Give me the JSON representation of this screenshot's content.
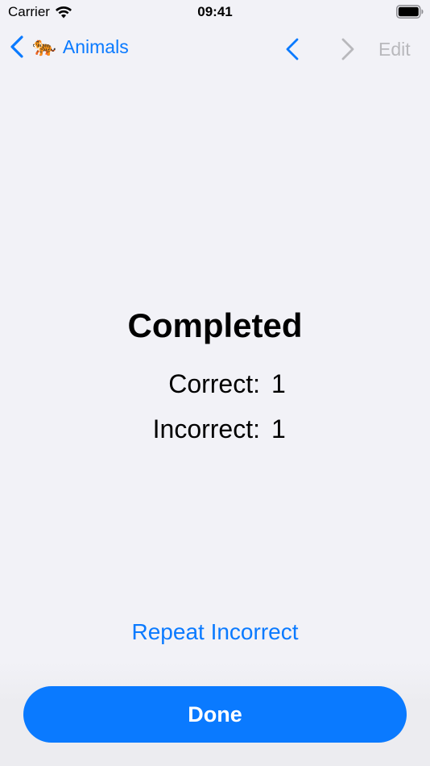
{
  "status_bar": {
    "carrier": "Carrier",
    "time": "09:41"
  },
  "nav": {
    "back_emoji": "🐅",
    "back_label": "Animals",
    "edit_label": "Edit",
    "accent_color": "#0a7aff",
    "disabled_color": "#b8b8bc"
  },
  "result": {
    "title": "Completed",
    "correct_label": "Correct:",
    "correct_value": "1",
    "incorrect_label": "Incorrect:",
    "incorrect_value": "1"
  },
  "actions": {
    "repeat_label": "Repeat Incorrect",
    "done_label": "Done"
  }
}
